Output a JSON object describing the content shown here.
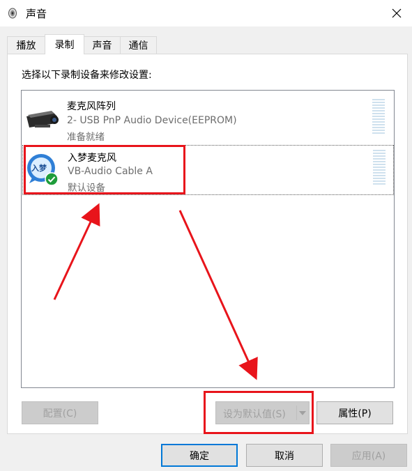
{
  "window": {
    "title": "声音",
    "icon": "speaker-icon",
    "close_icon": "close-icon"
  },
  "tabs": [
    {
      "label": "播放"
    },
    {
      "label": "录制"
    },
    {
      "label": "声音"
    },
    {
      "label": "通信"
    }
  ],
  "active_tab": "录制",
  "instruction": "选择以下录制设备来修改设置:",
  "devices": [
    {
      "name": "麦克风阵列",
      "description": "2- USB PnP Audio Device(EEPROM)",
      "status": "准备就绪",
      "icon": "webcam-microphone-icon",
      "selected": false,
      "default": false
    },
    {
      "name": "入梦麦克风",
      "description": "VB-Audio Cable A",
      "status": "默认设备",
      "icon": "bubble-microphone-icon",
      "icon_text": "入梦",
      "badge_icon": "green-check-icon",
      "selected": true,
      "default": true
    }
  ],
  "buttons": {
    "configure": "配置(C)",
    "set_default": "设为默认值(S)",
    "properties": "属性(P)",
    "ok": "确定",
    "cancel": "取消",
    "apply": "应用(A)"
  },
  "colors": {
    "annotation": "#e8141b",
    "focus_border": "#0078d7",
    "check_badge": "#1f9d3b"
  }
}
